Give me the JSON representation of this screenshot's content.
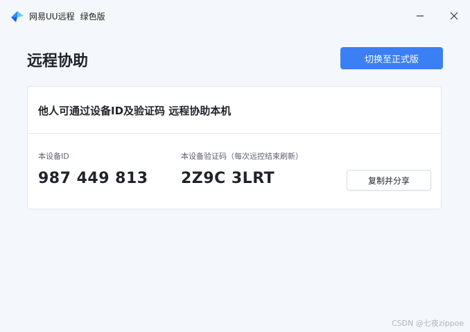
{
  "app": {
    "name": "网易UU远程",
    "edition": "绿色版",
    "logo_icon": "uu-logo-icon",
    "accent_color": "#3b7ff5"
  },
  "window": {
    "minimize_icon": "minimize-icon",
    "close_icon": "close-icon"
  },
  "page": {
    "title": "远程协助",
    "switch_label": "切换至正式版"
  },
  "card": {
    "title": "他人可通过设备ID及验证码 远程协助本机",
    "device_id_label": "本设备ID",
    "device_id_value": "987 449 813",
    "code_label": "本设备验证码（每次远控结束刷新）",
    "code_value": "2Z9C 3LRT",
    "copy_label": "复制并分享"
  },
  "watermark": "CSDN @七夜zippoe"
}
